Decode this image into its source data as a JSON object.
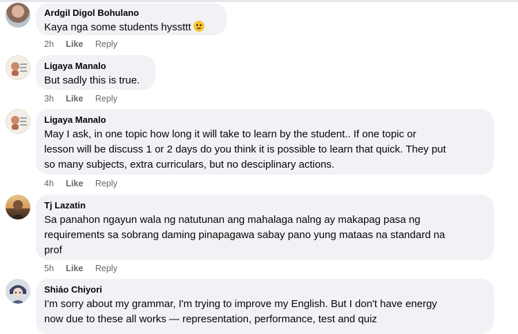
{
  "comments": [
    {
      "author": "Ardgil Digol Bohulano",
      "lines": [
        "Kaya nga some students hyssttt"
      ],
      "emoji": "disappointed-face",
      "time": "2h",
      "like": "Like",
      "reply": "Reply"
    },
    {
      "author": "Ligaya Manalo",
      "lines": [
        "But sadly this is true."
      ],
      "time": "3h",
      "like": "Like",
      "reply": "Reply"
    },
    {
      "author": "Ligaya Manalo",
      "lines": [
        "May I ask, in one topic how long it will take to learn by the student.. If one topic or",
        "lesson will be discuss 1 or 2 days do you think it is possible to learn that quick. They put",
        "so many subjects, extra curriculars, but no desciplinary actions."
      ],
      "time": "4h",
      "like": "Like",
      "reply": "Reply"
    },
    {
      "author": "Tj Lazatin",
      "lines": [
        "Sa panahon ngayun wala ng natutunan ang mahalaga nalng ay makapag pasa ng",
        "requirements sa sobrang daming pinapagawa sabay pano yung mataas na standard na",
        "prof"
      ],
      "time": "5h",
      "like": "Like",
      "reply": "Reply"
    },
    {
      "author": "Shiáo Chiyori",
      "lines": [
        "I'm sorry about my grammar, I'm trying to improve my English. But I don't have energy",
        "now due to these all works — representation, performance, test and quiz"
      ]
    }
  ]
}
